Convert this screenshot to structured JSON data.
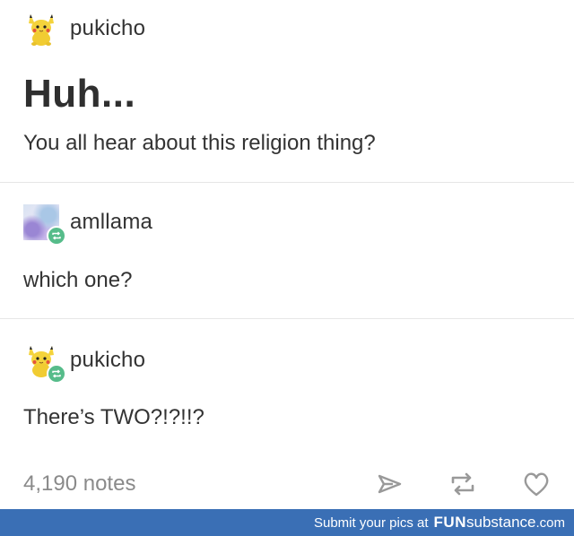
{
  "post": {
    "header": {
      "username": "pukicho",
      "avatar_icon": "pikachu-plush-avatar"
    },
    "title": "Huh...",
    "body": "You all hear about this religion thing?",
    "reblogs": [
      {
        "username": "amllama",
        "avatar_icon": "watercolor-avatar",
        "badge_icon": "reblog-icon",
        "text": "which one?"
      },
      {
        "username": "pukicho",
        "avatar_icon": "pikachu-plush-avatar",
        "badge_icon": "reblog-icon",
        "text": "There’s TWO?!?!!?"
      }
    ],
    "footer": {
      "notes": "4,190 notes",
      "actions": [
        "share-icon",
        "reblog-icon",
        "like-icon"
      ]
    }
  },
  "watermark": {
    "prefix": "Submit your pics at",
    "brand_bold": "FUN",
    "brand_rest": "substance",
    "tld": ".com",
    "color": "#3a6fb5"
  },
  "colors": {
    "reblog_badge": "#56bc8a",
    "divider": "#e6e6e6",
    "notes_text": "#8a8a8a"
  }
}
